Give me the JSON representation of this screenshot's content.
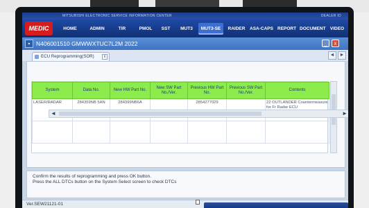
{
  "header": {
    "title": "MITSUBISHI ELECTRONIC SERVICE INFORMATION CENTER",
    "right_text": "DEALER ID"
  },
  "logo": "MEDIC",
  "menu": [
    {
      "label": "HOME"
    },
    {
      "label": "ADMIN"
    },
    {
      "label": "TIR"
    },
    {
      "label": "PMOL"
    },
    {
      "label": "SST"
    },
    {
      "label": "MUT3"
    },
    {
      "label": "MUT3-SE"
    },
    {
      "label": "RAIDER"
    },
    {
      "label": "ASA-CAPS"
    },
    {
      "label": "REPORT"
    },
    {
      "label": "DOCUMENT"
    },
    {
      "label": "VIDEO"
    }
  ],
  "active_menu": "MUT3-SE",
  "window": {
    "title": "N406001510  GMWWXTUC7L2M 2022",
    "min_symbol": "_",
    "close_symbol": "x"
  },
  "tab": {
    "label": "ECU Reprogramming(SOR)",
    "close_symbol": "x"
  },
  "nav": {
    "prev": "◄",
    "next": "►"
  },
  "table": {
    "columns": [
      "System",
      "Data No.",
      "New HW Part No.",
      "New SW Part No./Ver.",
      "Previous HW Part No.",
      "Previous SW Part No./Ver.",
      "Contents"
    ],
    "rows": [
      {
        "system": "LASER/RADAR",
        "data_no": "284359NB 5AN",
        "new_hw": "284399NB6A",
        "new_sw": "",
        "prev_hw": "2854277029",
        "prev_sw": "",
        "contents": "22 OUTLANDER Countermeasure for Fr Radar ECU"
      }
    ]
  },
  "message": {
    "line1": "Confirm the results of reprogramming and press OK button.",
    "line2": "Press the ALL DTCs button on the System Select screen to check DTCs"
  },
  "status": {
    "version": "Ver.SEW21121-01"
  },
  "colors": {
    "header_green": "#8cec4c",
    "menu_blue": "#163a88",
    "logo_red": "#d61d1d"
  }
}
